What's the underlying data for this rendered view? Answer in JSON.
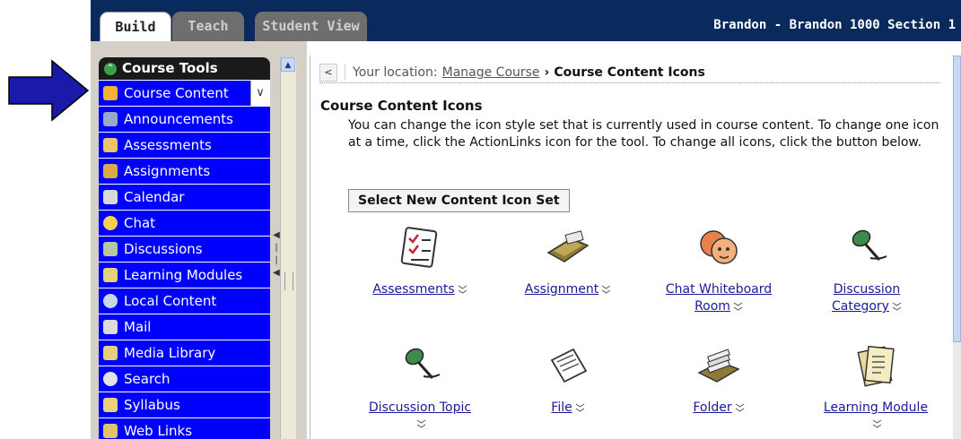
{
  "tabs": [
    "Build",
    "Teach",
    "Student View"
  ],
  "course_title": "Brandon - Brandon 1000 Section 1",
  "sidebar": {
    "header": "Course Tools",
    "items": [
      {
        "label": "Course Content",
        "icon": "home-icon"
      },
      {
        "label": "Announcements",
        "icon": "megaphone-icon"
      },
      {
        "label": "Assessments",
        "icon": "quiz-icon"
      },
      {
        "label": "Assignments",
        "icon": "assignment-icon"
      },
      {
        "label": "Calendar",
        "icon": "calendar-icon"
      },
      {
        "label": "Chat",
        "icon": "chat-icon"
      },
      {
        "label": "Discussions",
        "icon": "pushpin-icon"
      },
      {
        "label": "Learning Modules",
        "icon": "module-icon"
      },
      {
        "label": "Local Content",
        "icon": "disc-icon"
      },
      {
        "label": "Mail",
        "icon": "mail-icon"
      },
      {
        "label": "Media Library",
        "icon": "media-icon"
      },
      {
        "label": "Search",
        "icon": "search-icon"
      },
      {
        "label": "Syllabus",
        "icon": "syllabus-icon"
      },
      {
        "label": "Web Links",
        "icon": "link-icon"
      }
    ]
  },
  "breadcrumb": {
    "prefix": "Your location:",
    "link": "Manage Course",
    "separator": "›",
    "current": "Course Content Icons"
  },
  "page": {
    "title": "Course Content Icons",
    "description": "You can change the icon style set that is currently used in course content. To change one icon at a time, click the ActionLinks icon for the tool. To change all icons, click the button below.",
    "button": "Select New Content Icon Set"
  },
  "icons": [
    {
      "label": "Assessments",
      "icon": "quiz-icon"
    },
    {
      "label": "Assignment",
      "icon": "tray-icon"
    },
    {
      "label": "Chat Whiteboard Room",
      "icon": "chat-faces-icon"
    },
    {
      "label": "Discussion Category",
      "icon": "pushpin-icon"
    },
    {
      "label": "Discussion Topic",
      "icon": "pushpin-icon"
    },
    {
      "label": "File",
      "icon": "file-icon"
    },
    {
      "label": "Folder",
      "icon": "folder-icon"
    },
    {
      "label": "Learning Module",
      "icon": "module-icon"
    }
  ],
  "colors": {
    "nav_blue": "#0000ff",
    "topbar": "#0a2a5e",
    "arrow": "#1a1aa8"
  }
}
